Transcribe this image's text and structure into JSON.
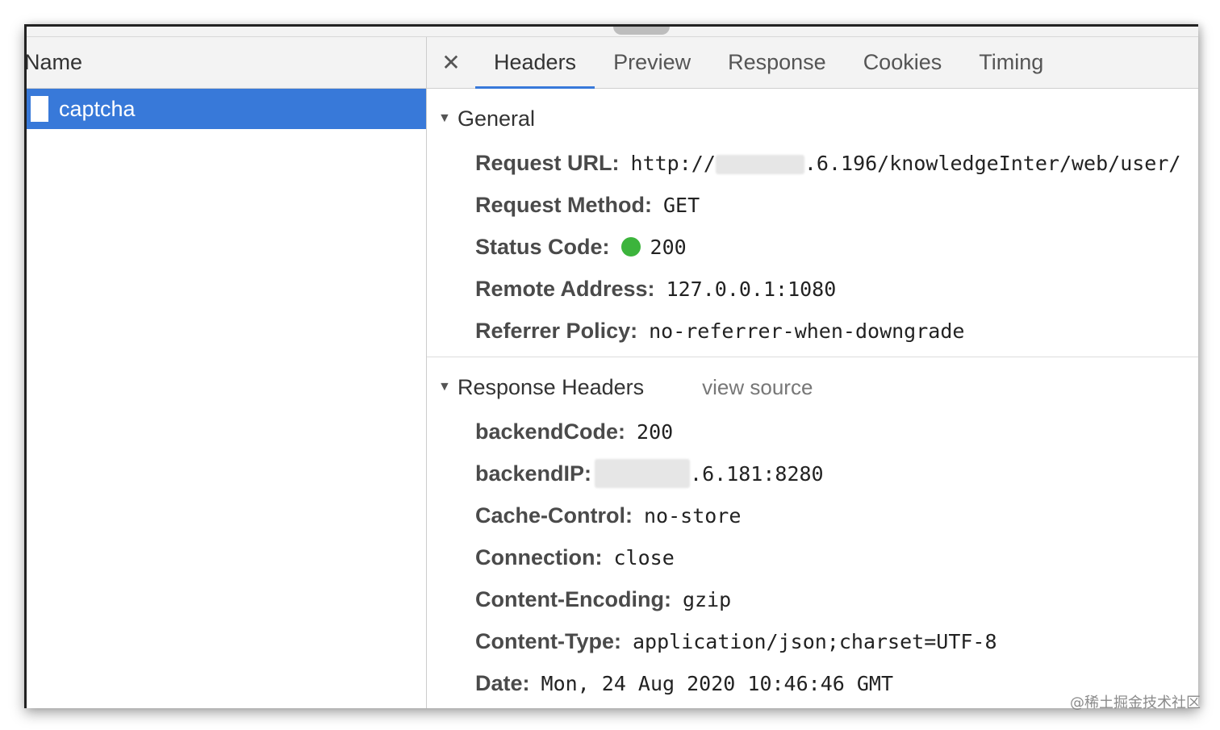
{
  "left_panel": {
    "column_header": "Name",
    "rows": [
      {
        "name": "captcha",
        "selected": true
      }
    ]
  },
  "tabs": {
    "close_symbol": "✕",
    "items": [
      {
        "label": "Headers",
        "active": true
      },
      {
        "label": "Preview",
        "active": false
      },
      {
        "label": "Response",
        "active": false
      },
      {
        "label": "Cookies",
        "active": false
      },
      {
        "label": "Timing",
        "active": false
      }
    ]
  },
  "general": {
    "title": "General",
    "request_url": {
      "key": "Request URL:",
      "prefix": "http://",
      "suffix": ".6.196/knowledgeInter/web/user/"
    },
    "request_method": {
      "key": "Request Method:",
      "value": "GET"
    },
    "status_code": {
      "key": "Status Code:",
      "value": "200",
      "dot_color": "#3cb43c"
    },
    "remote_address": {
      "key": "Remote Address:",
      "value": "127.0.0.1:1080"
    },
    "referrer_policy": {
      "key": "Referrer Policy:",
      "value": "no-referrer-when-downgrade"
    }
  },
  "response_headers": {
    "title": "Response Headers",
    "view_source": "view source",
    "items": [
      {
        "key": "backendCode:",
        "value": "200"
      },
      {
        "key": "backendIP:",
        "value": ".6.181:8280"
      },
      {
        "key": "Cache-Control:",
        "value": "no-store"
      },
      {
        "key": "Connection:",
        "value": "close"
      },
      {
        "key": "Content-Encoding:",
        "value": "gzip"
      },
      {
        "key": "Content-Type:",
        "value": "application/json;charset=UTF-8"
      },
      {
        "key": "Date:",
        "value": "Mon, 24 Aug 2020 10:46:46 GMT"
      }
    ]
  },
  "watermark": "@稀土掘金技术社区",
  "colors": {
    "accent": "#3879d9",
    "status_ok": "#3cb43c"
  }
}
